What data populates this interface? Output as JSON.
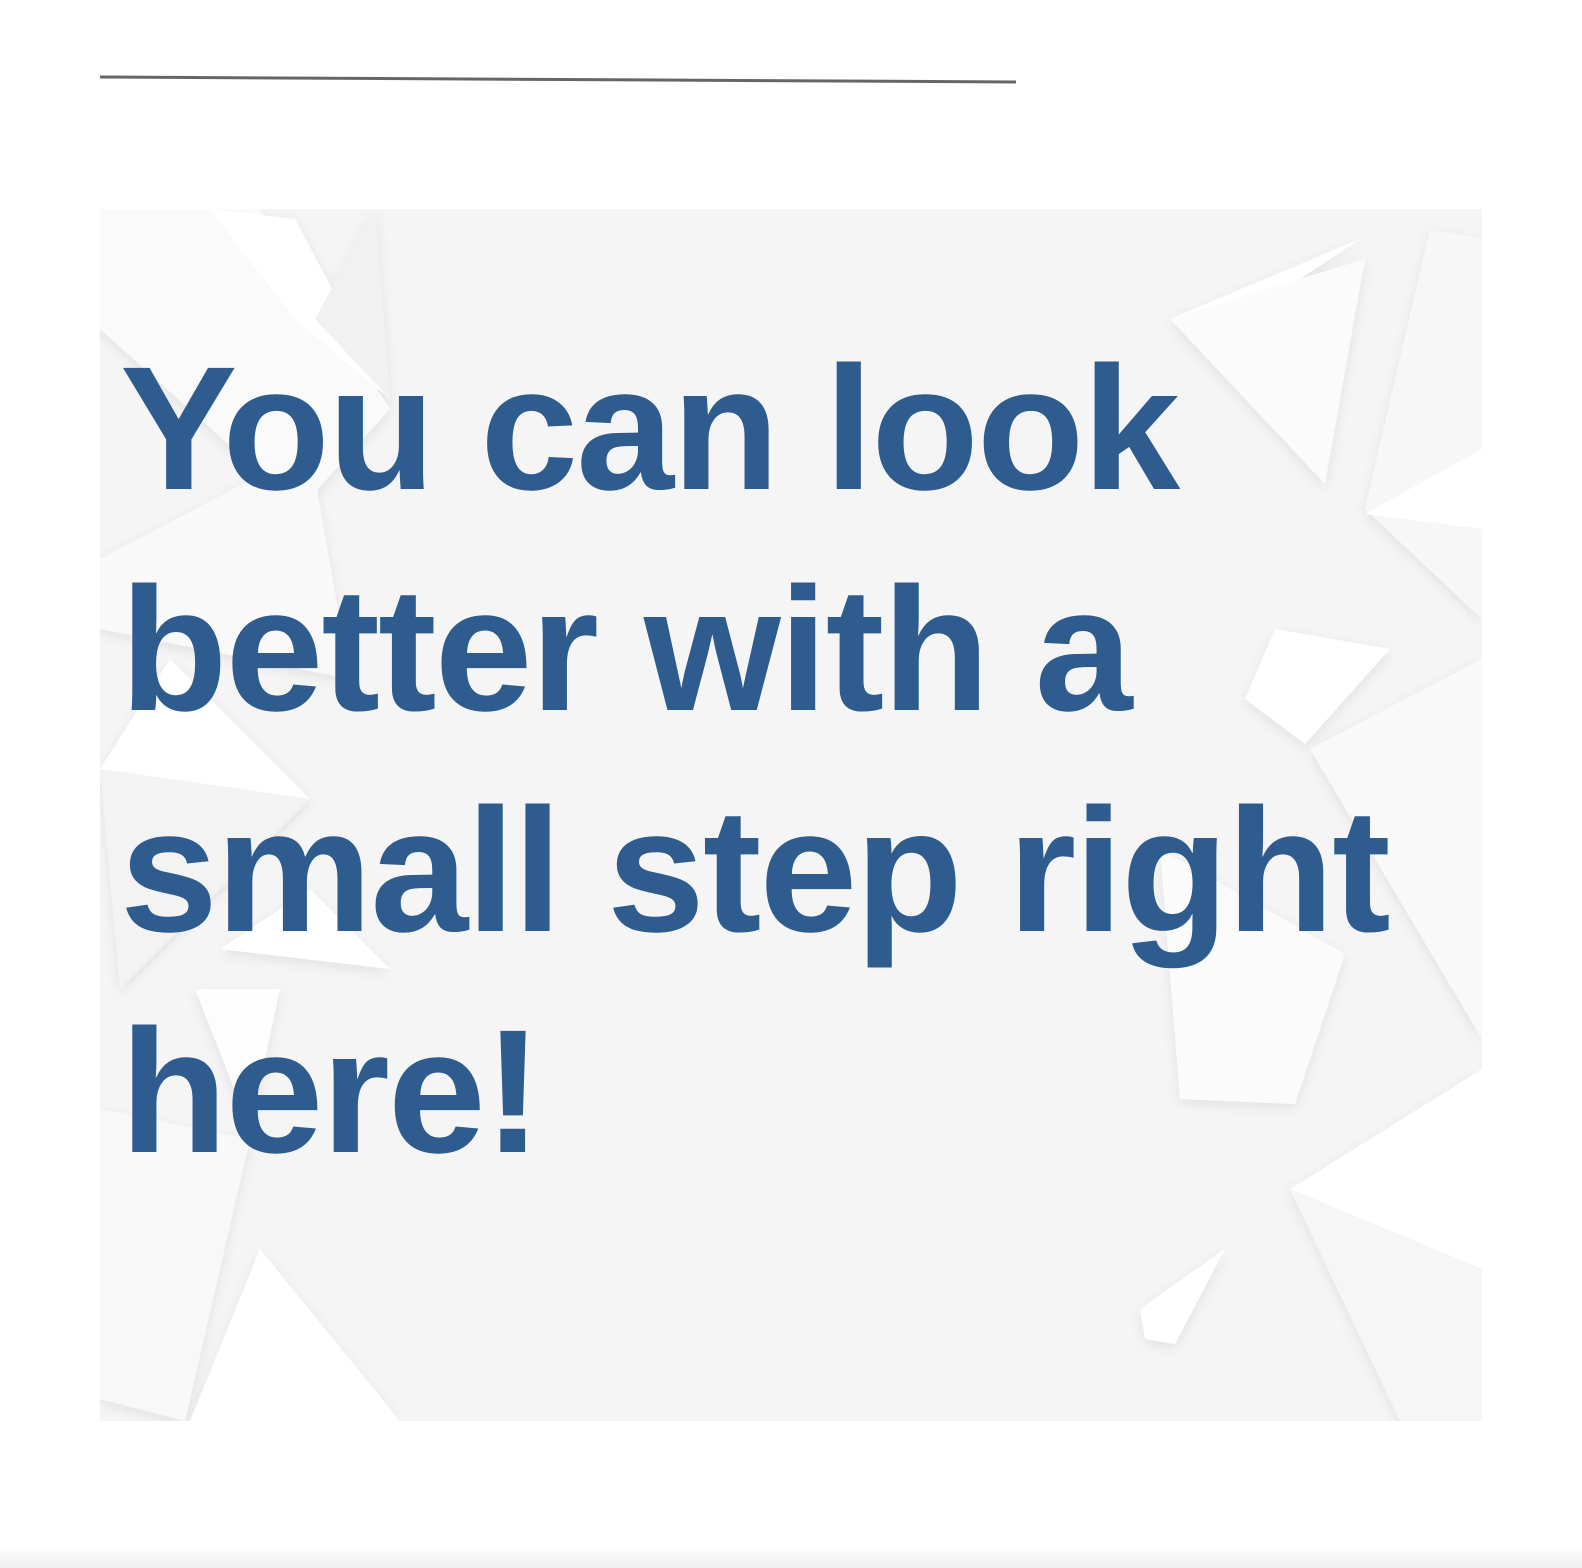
{
  "headline": "You can look better with a small step right here!",
  "colors": {
    "headline": "#2e5c8f",
    "panel_background": "#f5f5f5",
    "rule": "#666666"
  }
}
